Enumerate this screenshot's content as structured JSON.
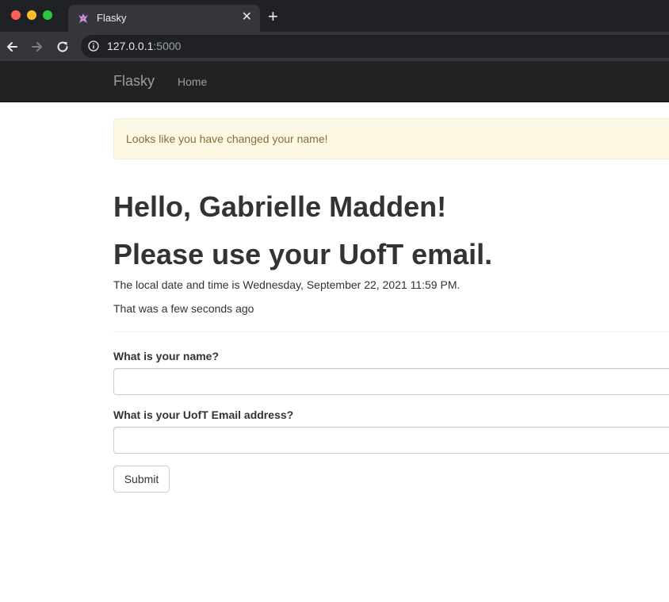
{
  "browser": {
    "tab_title": "Flasky",
    "tab_close": "✕",
    "new_tab": "+",
    "url_host": "127.0.0.1",
    "url_port": ":5000"
  },
  "navbar": {
    "brand": "Flasky",
    "home": "Home",
    "background": "#222222"
  },
  "alert": {
    "message": "Looks like you have changed your name!",
    "background": "#fcf8e3",
    "text_color": "#8a6d3b"
  },
  "main": {
    "greeting": "Hello, Gabrielle Madden!",
    "email_prompt": "Please use your UofT email.",
    "datetime_text": "The local date and time is Wednesday, September 22, 2021 11:59 PM.",
    "relative_time": "That was a few seconds ago"
  },
  "form": {
    "name_label": "What is your name?",
    "name_value": "",
    "email_label": "What is your UofT Email address?",
    "email_value": "",
    "submit_label": "Submit"
  }
}
